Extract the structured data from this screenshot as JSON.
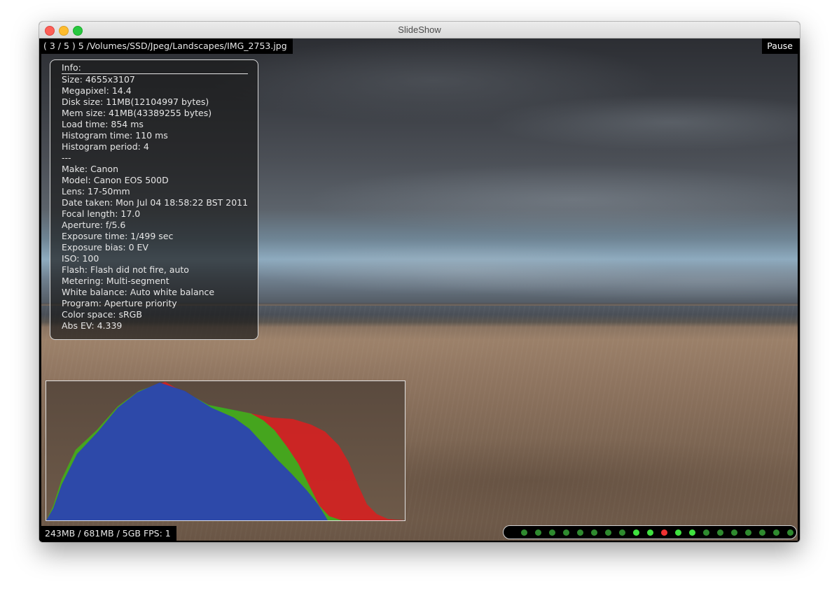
{
  "window": {
    "title": "SlideShow"
  },
  "topbar": {
    "path_text": "( 3 / 5 ) 5  /Volumes/SSD/Jpeg/Landscapes/IMG_2753.jpg",
    "pause_label": "Pause"
  },
  "info": {
    "title": "Info:",
    "lines": [
      "Size: 4655x3107",
      "Megapixel: 14.4",
      "Disk size: 11MB(12104997 bytes)",
      "Mem size: 41MB(43389255 bytes)",
      "Load time: 854 ms",
      "Histogram time: 110 ms",
      "Histogram period: 4",
      "---",
      "Make: Canon",
      "Model: Canon EOS 500D",
      "Lens: 17-50mm",
      "Date taken: Mon Jul 04 18:58:22 BST 2011",
      "Focal length: 17.0",
      "Aperture: f/5.6",
      "Exposure time: 1/499 sec",
      "Exposure bias: 0 EV",
      "ISO: 100",
      "Flash: Flash did not fire, auto",
      "Metering: Multi-segment",
      "White balance: Auto white balance",
      "Program: Aperture priority",
      "Color space: sRGB",
      "Abs EV: 4.339"
    ]
  },
  "status": {
    "text": "243MB / 681MB / 5GB FPS: 1"
  },
  "histogram": {
    "colors": {
      "red": "#d42222",
      "green": "#3ab01e",
      "blue": "#2a3fb8"
    }
  },
  "slide_dots": {
    "colors": {
      "seen": "#2e8a2e",
      "cached": "#3fe23f",
      "current": "#f03232"
    },
    "states": [
      "seen",
      "seen",
      "seen",
      "seen",
      "seen",
      "seen",
      "seen",
      "seen",
      "cached",
      "cached",
      "current",
      "cached",
      "cached",
      "seen",
      "seen",
      "seen",
      "seen",
      "seen",
      "seen",
      "seen"
    ]
  }
}
